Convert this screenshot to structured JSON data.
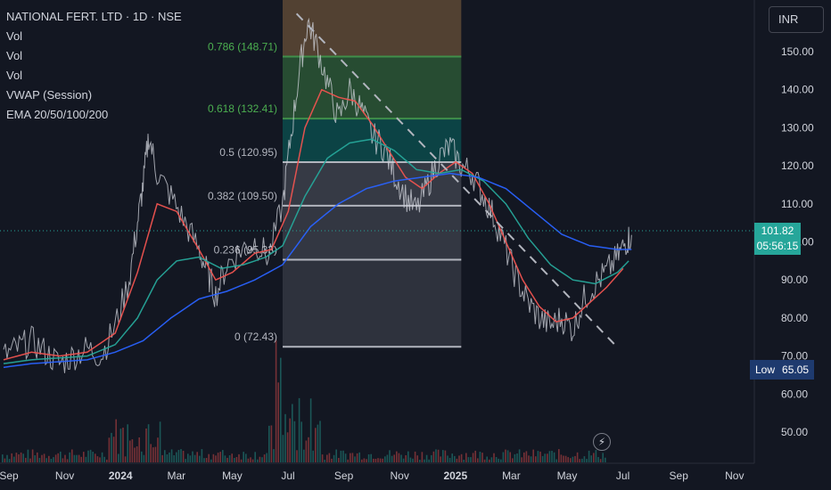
{
  "legend": {
    "symbol": "NATIONAL FERT. LTD · 1D · NSE",
    "indicators": [
      "Vol",
      "Vol",
      "Vol",
      "VWAP (Session)",
      "EMA 20/50/100/200"
    ]
  },
  "currency_button": "INR",
  "last_price": {
    "value": "101.82",
    "countdown": "05:56:15"
  },
  "low_marker": {
    "label": "Low",
    "value": "65.05"
  },
  "chart_data": {
    "type": "line",
    "title": "NATIONAL FERT. LTD · 1D · NSE",
    "x_ticks": [
      "Sep",
      "Nov",
      "2024",
      "Mar",
      "May",
      "Jul",
      "Sep",
      "Nov",
      "2025",
      "Mar",
      "May",
      "Jul",
      "Sep",
      "Nov"
    ],
    "y_ticks": [
      50,
      60,
      70,
      80,
      90,
      100,
      110,
      120,
      130,
      140,
      150
    ],
    "y_tick_labels": [
      "50.00",
      "60.00",
      "70.00",
      "80.00",
      "90.00",
      "100.00",
      "110.00",
      "120.00",
      "130.00",
      "140.00",
      "150.00"
    ],
    "ylim": [
      44,
      160
    ],
    "xlim": [
      0,
      28
    ],
    "x_unit": "months since Sep 2023 (x=0 at Sep 2023 tick)",
    "fib_levels": [
      {
        "ratio": "0.786",
        "price": 148.71,
        "label": "0.786 (148.71)"
      },
      {
        "ratio": "0.618",
        "price": 132.41,
        "label": "0.618 (132.41)"
      },
      {
        "ratio": "0.5",
        "price": 120.95,
        "label": "0.5 (120.95)"
      },
      {
        "ratio": "0.382",
        "price": 109.5,
        "label": "0.382 (109.50)"
      },
      {
        "ratio": "0.236",
        "price": 95.33,
        "label": "0.236 (95.33)"
      },
      {
        "ratio": "0",
        "price": 72.43,
        "label": "0 (72.43)"
      }
    ],
    "fib_x_range": [
      10.0,
      16.4
    ],
    "fib_top_price": 169,
    "trendline": [
      [
        10.5,
        160
      ],
      [
        21.9,
        73
      ]
    ],
    "series": [
      {
        "name": "Price",
        "color": "#d1d4dc",
        "points": [
          [
            0,
            70
          ],
          [
            0.5,
            72
          ],
          [
            1,
            74
          ],
          [
            1.5,
            71
          ],
          [
            2,
            68
          ],
          [
            2.5,
            70
          ],
          [
            3,
            72
          ],
          [
            3.5,
            70
          ],
          [
            4,
            78
          ],
          [
            4.5,
            90
          ],
          [
            4.8,
            105
          ],
          [
            5,
            115
          ],
          [
            5.2,
            128
          ],
          [
            5.5,
            118
          ],
          [
            6,
            112
          ],
          [
            6.5,
            105
          ],
          [
            7,
            98
          ],
          [
            7.3,
            92
          ],
          [
            7.6,
            86
          ],
          [
            8,
            94
          ],
          [
            8.5,
            98
          ],
          [
            9,
            100
          ],
          [
            9.5,
            96
          ],
          [
            10,
            110
          ],
          [
            10.3,
            128
          ],
          [
            10.6,
            145
          ],
          [
            10.9,
            158
          ],
          [
            11.2,
            152
          ],
          [
            11.6,
            142
          ],
          [
            12,
            132
          ],
          [
            12.4,
            140
          ],
          [
            12.8,
            135
          ],
          [
            13.2,
            128
          ],
          [
            13.6,
            125
          ],
          [
            14,
            118
          ],
          [
            14.4,
            112
          ],
          [
            14.8,
            108
          ],
          [
            15.2,
            115
          ],
          [
            15.6,
            122
          ],
          [
            16,
            125
          ],
          [
            16.4,
            120
          ],
          [
            16.8,
            118
          ],
          [
            17.2,
            112
          ],
          [
            17.6,
            106
          ],
          [
            18,
            98
          ],
          [
            18.4,
            90
          ],
          [
            18.8,
            84
          ],
          [
            19.2,
            80
          ],
          [
            19.6,
            78
          ],
          [
            20,
            80
          ],
          [
            20.4,
            77
          ],
          [
            20.8,
            85
          ],
          [
            21.2,
            89
          ],
          [
            21.6,
            92
          ],
          [
            22,
            96
          ],
          [
            22.3,
            100
          ],
          [
            22.5,
            101.82
          ]
        ]
      },
      {
        "name": "EMA 20",
        "color": "#ef5350",
        "points": [
          [
            0,
            69
          ],
          [
            1,
            71
          ],
          [
            2,
            70
          ],
          [
            3,
            71
          ],
          [
            4,
            76
          ],
          [
            4.8,
            92
          ],
          [
            5.5,
            110
          ],
          [
            6.2,
            108
          ],
          [
            7,
            98
          ],
          [
            7.6,
            90
          ],
          [
            8.2,
            92
          ],
          [
            9,
            97
          ],
          [
            9.6,
            98
          ],
          [
            10.2,
            108
          ],
          [
            10.8,
            130
          ],
          [
            11.4,
            140
          ],
          [
            12,
            138
          ],
          [
            12.6,
            137
          ],
          [
            13.2,
            131
          ],
          [
            13.8,
            124
          ],
          [
            14.4,
            117
          ],
          [
            15,
            114
          ],
          [
            15.6,
            118
          ],
          [
            16.2,
            121
          ],
          [
            16.8,
            118
          ],
          [
            17.4,
            110
          ],
          [
            18,
            100
          ],
          [
            18.6,
            90
          ],
          [
            19.2,
            83
          ],
          [
            19.8,
            79
          ],
          [
            20.4,
            80
          ],
          [
            21,
            84
          ],
          [
            21.6,
            88
          ],
          [
            22.2,
            93
          ]
        ]
      },
      {
        "name": "EMA 50",
        "color": "#26a69a",
        "points": [
          [
            0,
            68
          ],
          [
            1,
            69
          ],
          [
            2,
            69.5
          ],
          [
            3,
            70
          ],
          [
            4,
            73
          ],
          [
            4.8,
            80
          ],
          [
            5.5,
            90
          ],
          [
            6.2,
            95
          ],
          [
            7,
            96
          ],
          [
            7.8,
            93
          ],
          [
            8.6,
            94
          ],
          [
            9.4,
            96
          ],
          [
            10,
            99
          ],
          [
            10.8,
            112
          ],
          [
            11.6,
            122
          ],
          [
            12.4,
            126
          ],
          [
            13.2,
            127
          ],
          [
            14,
            124
          ],
          [
            14.8,
            119
          ],
          [
            15.6,
            118
          ],
          [
            16.4,
            119
          ],
          [
            17.2,
            116
          ],
          [
            18,
            110
          ],
          [
            18.8,
            101
          ],
          [
            19.6,
            94
          ],
          [
            20.4,
            90
          ],
          [
            21.2,
            89
          ],
          [
            22,
            92
          ],
          [
            22.4,
            95
          ]
        ]
      },
      {
        "name": "EMA 100",
        "color": "#2962ff",
        "points": [
          [
            0,
            67
          ],
          [
            1,
            68
          ],
          [
            2,
            68.5
          ],
          [
            3,
            69
          ],
          [
            4,
            71
          ],
          [
            5,
            74
          ],
          [
            6,
            80
          ],
          [
            7,
            85
          ],
          [
            8,
            87
          ],
          [
            9,
            90
          ],
          [
            10,
            94
          ],
          [
            11,
            104
          ],
          [
            12,
            110
          ],
          [
            13,
            114
          ],
          [
            14,
            116
          ],
          [
            15,
            117
          ],
          [
            16,
            118
          ],
          [
            17,
            117
          ],
          [
            18,
            114
          ],
          [
            19,
            108
          ],
          [
            20,
            102
          ],
          [
            21,
            99
          ],
          [
            22,
            98
          ],
          [
            22.5,
            98
          ]
        ]
      }
    ]
  }
}
